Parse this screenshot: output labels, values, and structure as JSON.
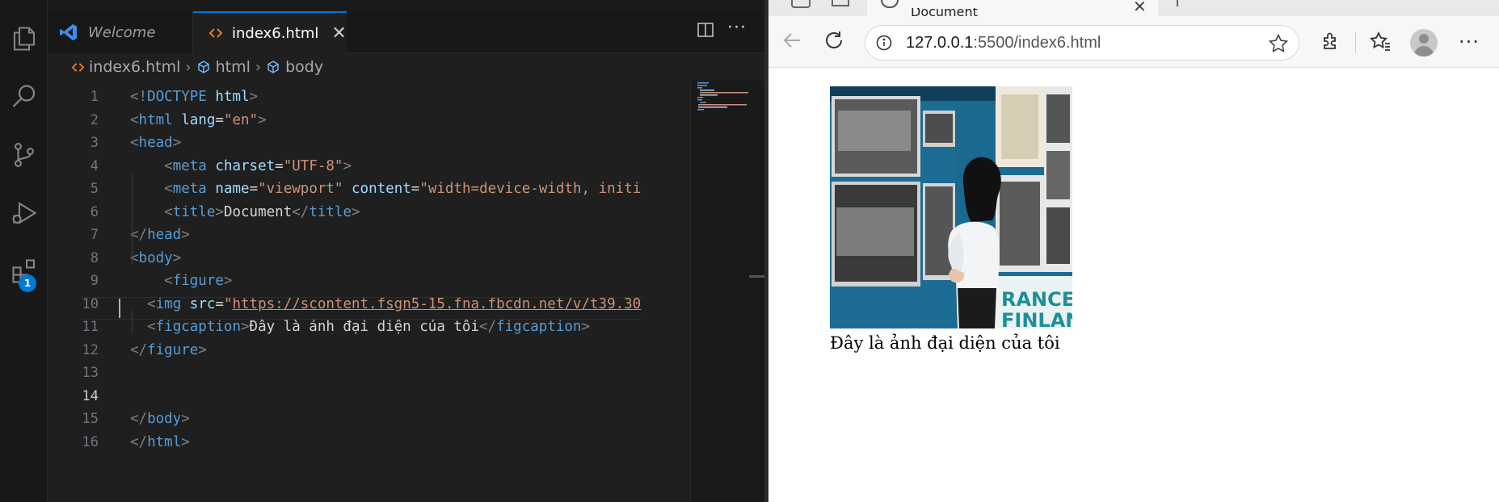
{
  "editor": {
    "tabs": [
      {
        "label": "Welcome"
      },
      {
        "label": "index6.html"
      }
    ],
    "breadcrumb": [
      "index6.html",
      "html",
      "body"
    ],
    "line_numbers": [
      "1",
      "2",
      "3",
      "4",
      "5",
      "6",
      "7",
      "8",
      "9",
      "10",
      "11",
      "12",
      "13",
      "14",
      "15",
      "16"
    ],
    "lines": [
      [
        [
          "b",
          "<!"
        ],
        [
          "t",
          "DOCTYPE"
        ],
        [
          "tx",
          " "
        ],
        [
          "a",
          "html"
        ],
        [
          "b",
          ">"
        ]
      ],
      [
        [
          "b",
          "<"
        ],
        [
          "t",
          "html"
        ],
        [
          "tx",
          " "
        ],
        [
          "a",
          "lang"
        ],
        [
          "tx",
          "="
        ],
        [
          "s",
          "\"en\""
        ],
        [
          "b",
          ">"
        ]
      ],
      [
        [
          "b",
          "<"
        ],
        [
          "t",
          "head"
        ],
        [
          "b",
          ">"
        ]
      ],
      [
        [
          "tx",
          "    "
        ],
        [
          "b",
          "<"
        ],
        [
          "t",
          "meta"
        ],
        [
          "tx",
          " "
        ],
        [
          "a",
          "charset"
        ],
        [
          "tx",
          "="
        ],
        [
          "s",
          "\"UTF-8\""
        ],
        [
          "b",
          ">"
        ]
      ],
      [
        [
          "tx",
          "    "
        ],
        [
          "b",
          "<"
        ],
        [
          "t",
          "meta"
        ],
        [
          "tx",
          " "
        ],
        [
          "a",
          "name"
        ],
        [
          "tx",
          "="
        ],
        [
          "s",
          "\"viewport\""
        ],
        [
          "tx",
          " "
        ],
        [
          "a",
          "content"
        ],
        [
          "tx",
          "="
        ],
        [
          "s",
          "\"width=device-width, initi"
        ]
      ],
      [
        [
          "tx",
          "    "
        ],
        [
          "b",
          "<"
        ],
        [
          "t",
          "title"
        ],
        [
          "b",
          ">"
        ],
        [
          "tx",
          "Document"
        ],
        [
          "b",
          "</"
        ],
        [
          "t",
          "title"
        ],
        [
          "b",
          ">"
        ]
      ],
      [
        [
          "b",
          "</"
        ],
        [
          "t",
          "head"
        ],
        [
          "b",
          ">"
        ]
      ],
      [
        [
          "b",
          "<"
        ],
        [
          "t",
          "body"
        ],
        [
          "b",
          ">"
        ]
      ],
      [
        [
          "tx",
          "    "
        ],
        [
          "b",
          "<"
        ],
        [
          "t",
          "figure"
        ],
        [
          "b",
          ">"
        ]
      ],
      [
        [
          "tx",
          "  "
        ],
        [
          "b",
          "<"
        ],
        [
          "t",
          "img"
        ],
        [
          "tx",
          " "
        ],
        [
          "a",
          "src"
        ],
        [
          "tx",
          "="
        ],
        [
          "s",
          "\""
        ],
        [
          "su",
          "https://scontent.fsgn5-15.fna.fbcdn.net/v/t39.30"
        ]
      ],
      [
        [
          "tx",
          "  "
        ],
        [
          "b",
          "<"
        ],
        [
          "t",
          "figcaption"
        ],
        [
          "b",
          ">"
        ],
        [
          "tx",
          "Đây là ảnh đại diện của tôi"
        ],
        [
          "b",
          "</"
        ],
        [
          "t",
          "figcaption"
        ],
        [
          "b",
          ">"
        ]
      ],
      [
        [
          "b",
          "</"
        ],
        [
          "t",
          "figure"
        ],
        [
          "b",
          ">"
        ]
      ],
      [],
      [
        [
          "tx",
          "    "
        ]
      ],
      [
        [
          "b",
          "</"
        ],
        [
          "t",
          "body"
        ],
        [
          "b",
          ">"
        ]
      ],
      [
        [
          "b",
          "</"
        ],
        [
          "t",
          "html"
        ],
        [
          "b",
          ">"
        ]
      ]
    ],
    "current_line": "14",
    "extensions_badge": "1",
    "icons": [
      "explorer-icon",
      "search-icon",
      "source-control-icon",
      "run-debug-icon",
      "extensions-icon",
      "split-editor-icon",
      "more-actions-icon"
    ]
  },
  "browser": {
    "tab_title": "Document",
    "url_host": "127.0.0.1",
    "url_rest": ":5500/index6.html",
    "caption": "Đây là ảnh đại diện của tôi",
    "image_alt": "photo of a woman looking at historical photographs on a blue exhibition wall",
    "icons": [
      "back-icon",
      "reload-icon",
      "site-info-icon",
      "favorite-star-icon",
      "extensions-icon",
      "favorites-icon",
      "profile-icon",
      "more-icon"
    ]
  },
  "colors": {
    "tag": "#569cd6",
    "attribute": "#9cdcfe",
    "string": "#ce9178",
    "bracket": "#808080",
    "accent": "#0078d4"
  }
}
